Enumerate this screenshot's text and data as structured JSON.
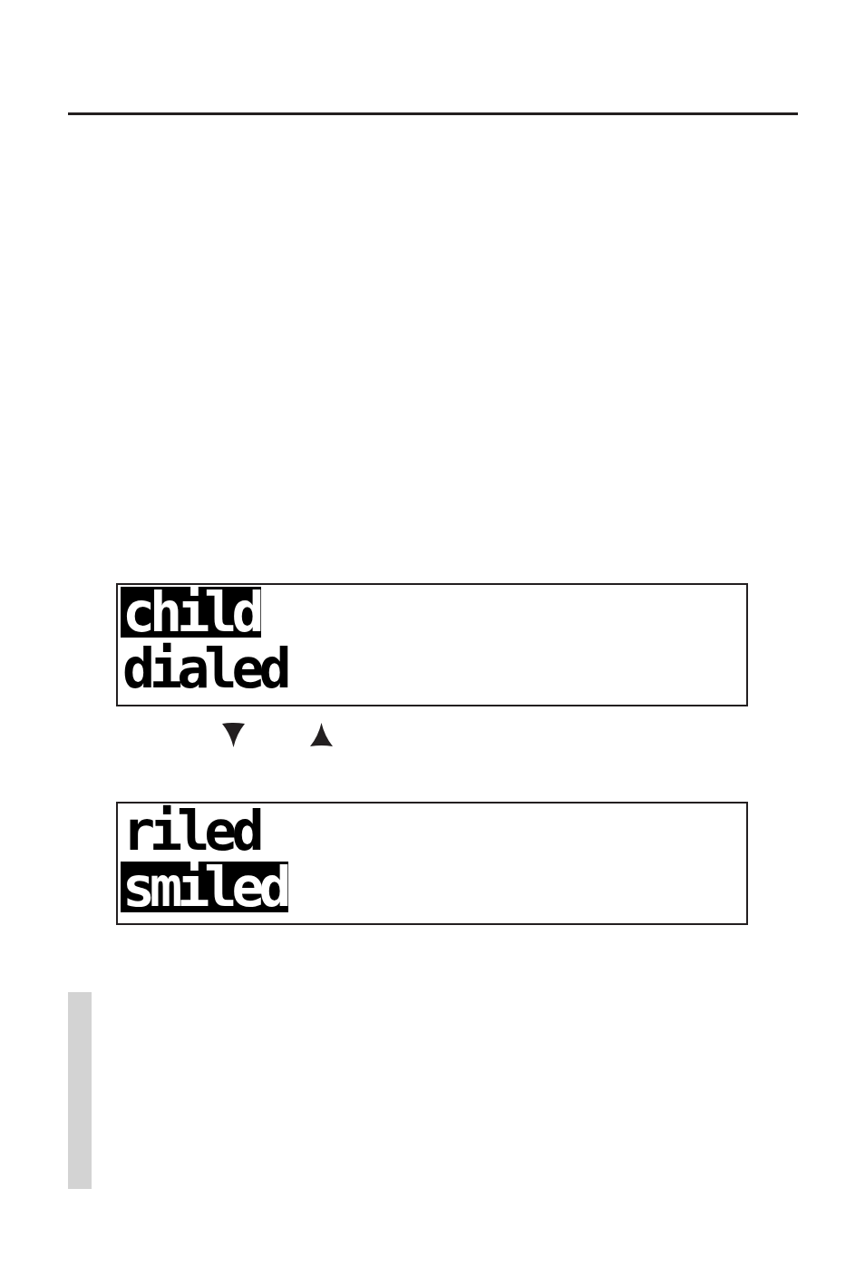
{
  "displays": [
    {
      "lines": [
        {
          "text": "child",
          "selected": true
        },
        {
          "text": "dialed",
          "selected": false
        }
      ]
    },
    {
      "lines": [
        {
          "text": "riled",
          "selected": false
        },
        {
          "text": "smiled",
          "selected": true
        }
      ]
    }
  ]
}
